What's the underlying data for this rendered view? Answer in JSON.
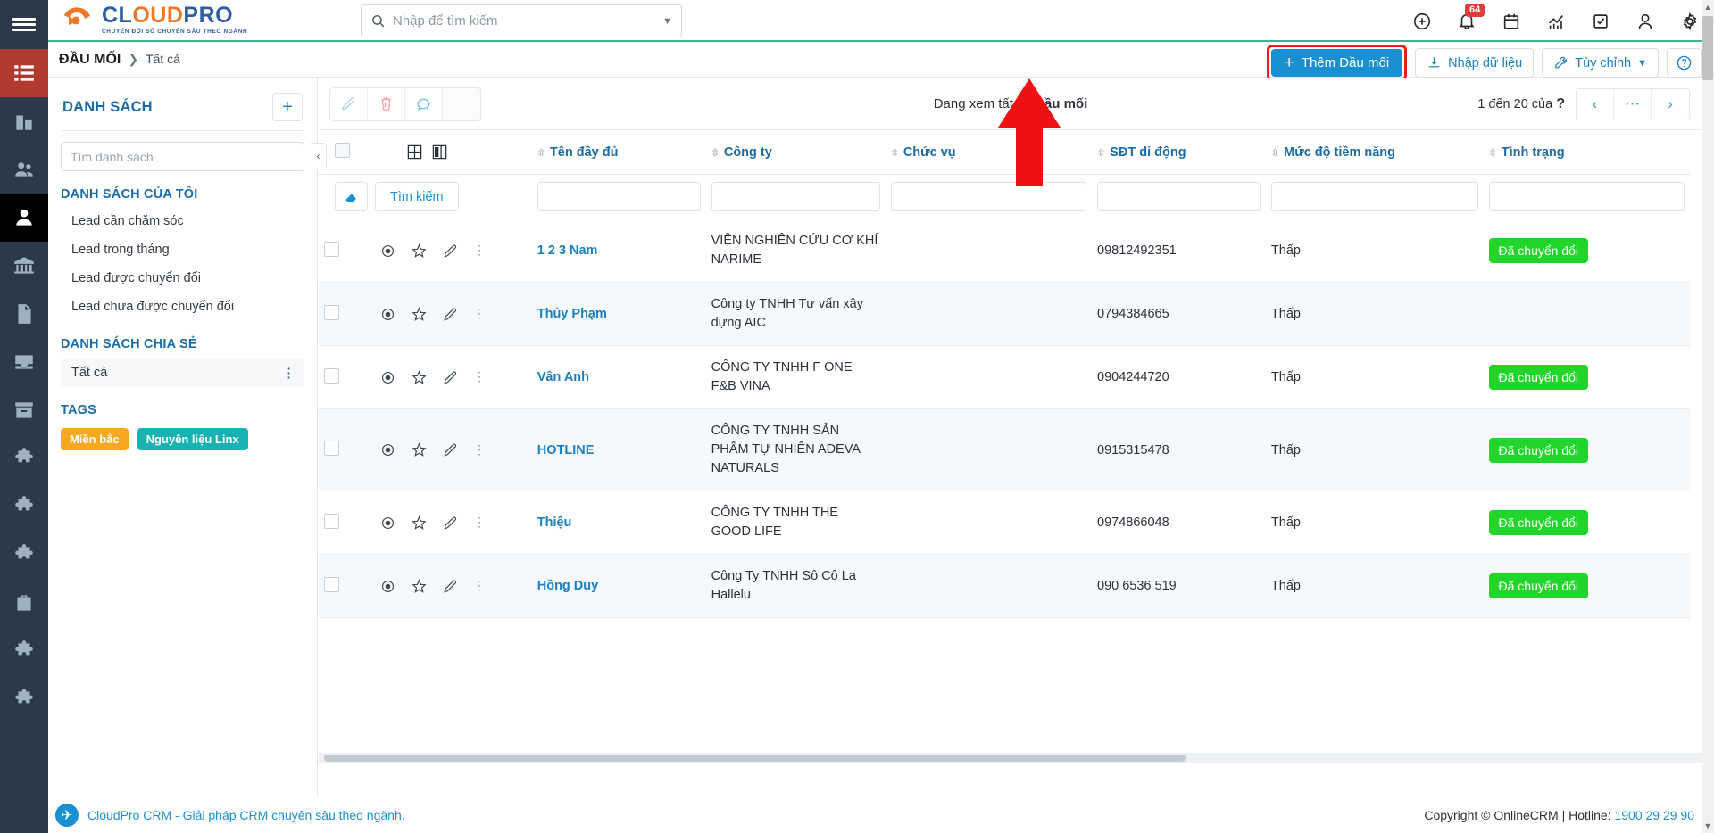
{
  "brand": {
    "title_blue": "CL",
    "title_orange": "OUD",
    "title_blue2": "PRO",
    "tagline": "CHUYỂN ĐỔI SỐ CHUYÊN SÂU THEO NGÀNH"
  },
  "search": {
    "placeholder": "Nhập để tìm kiếm",
    "value": ""
  },
  "topicons": {
    "notification_count": "64",
    "items": [
      "plus-circle-icon",
      "bell-icon",
      "calendar-icon",
      "analytics-icon",
      "task-check-icon",
      "user-icon",
      "gear-icon"
    ]
  },
  "breadcrumb": {
    "main": "ĐẦU MỐI",
    "separator": "❯",
    "sub": "Tất cả"
  },
  "header_actions": {
    "add_label": "Thêm Đầu mối",
    "import_label": "Nhập dữ liệu",
    "customize_label": "Tùy chỉnh",
    "help_label": "?"
  },
  "sidebar": {
    "title": "DANH SÁCH",
    "add_tooltip": "+",
    "search_placeholder": "Tìm danh sách",
    "search_value": "",
    "my_lists_title": "DANH SÁCH CỦA TÔI",
    "my_lists": [
      "Lead cần chăm sóc",
      "Lead trong tháng",
      "Lead được chuyển đổi",
      "Lead chưa được chuyển đổi"
    ],
    "shared_title": "DANH SÁCH CHIA SẺ",
    "shared_items": [
      {
        "label": "Tất cả"
      }
    ],
    "tags_title": "TAGS",
    "tags": [
      {
        "label": "Miền bắc",
        "color": "#f6a821"
      },
      {
        "label": "Nguyên liệu Linx",
        "color": "#17b3b3"
      }
    ]
  },
  "grid_toolbar": {
    "view_prefix": "Đang xem tất cả ",
    "view_bold": "Đầu mối",
    "pager_text": "1 đến 20 của",
    "pager_unknown": "?",
    "prev": "‹",
    "more": "⋯",
    "next": "›"
  },
  "table": {
    "columns": [
      "Tên đầy đủ",
      "Công ty",
      "Chức vụ",
      "SĐT di động",
      "Mức độ tiềm năng",
      "Tình trạng"
    ],
    "filter": {
      "erase_icon": "eraser-icon",
      "search_label": "Tìm kiếm",
      "values": [
        "",
        "",
        "",
        "",
        "",
        ""
      ]
    },
    "rows": [
      {
        "name": "1 2 3 Nam",
        "company": "VIỆN NGHIÊN CỨU CƠ KHÍ NARIME",
        "role": "",
        "phone": "09812492351",
        "potential": "Thấp",
        "status": "Đã chuyển đổi"
      },
      {
        "name": "Thủy Phạm",
        "company": "Công ty TNHH Tư vấn xây dựng AIC",
        "role": "",
        "phone": "0794384665",
        "potential": "Thấp",
        "status": ""
      },
      {
        "name": "Vân Anh",
        "company": "CÔNG TY TNHH F ONE F&B VINA",
        "role": "",
        "phone": "0904244720",
        "potential": "Thấp",
        "status": "Đã chuyển đổi"
      },
      {
        "name": "HOTLINE",
        "company": "CÔNG TY TNHH SẢN PHẨM TỰ NHIÊN ADEVA NATURALS",
        "role": "",
        "phone": "0915315478",
        "potential": "Thấp",
        "status": "Đã chuyển đổi"
      },
      {
        "name": "Thiệu",
        "company": "CÔNG TY TNHH THE GOOD LIFE",
        "role": "",
        "phone": "0974866048",
        "potential": "Thấp",
        "status": "Đã chuyển đổi"
      },
      {
        "name": "Hồng Duy",
        "company": "Công Ty TNHH Sô Cô La Hallelu",
        "role": "",
        "phone": "090 6536 519",
        "potential": "Thấp",
        "status": "Đã chuyển đổi"
      }
    ]
  },
  "footer": {
    "left_text": "CloudPro CRM - Giải pháp CRM chuyên sâu theo ngành.",
    "copyright": "Copyright © OnlineCRM | Hotline: ",
    "phone": "1900 29 29 90"
  },
  "colors": {
    "accent_blue": "#1a8fd1",
    "brand_orange": "#ef7622",
    "success_green": "#22d52a",
    "danger_red": "#f01b1b",
    "header_link": "#1a6ca8"
  }
}
